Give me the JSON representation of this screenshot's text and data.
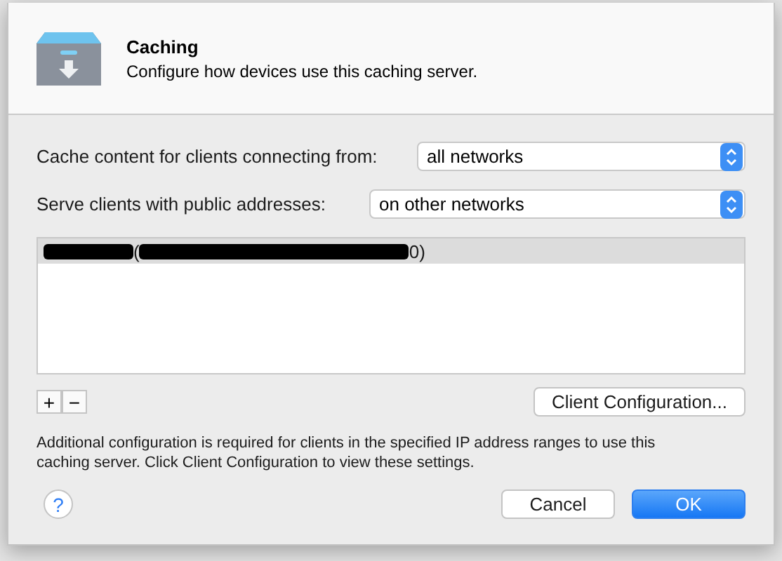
{
  "header": {
    "title": "Caching",
    "subtitle": "Configure how devices use this caching server."
  },
  "settings": [
    {
      "label": "Cache content for clients connecting from:",
      "value": "all networks"
    },
    {
      "label": "Serve clients with public addresses:",
      "value": "on other networks"
    }
  ],
  "ranges": [
    {
      "selected": true,
      "redacted": true,
      "text_before": "(",
      "text_after": "0)"
    }
  ],
  "list_buttons": [
    "+",
    "−"
  ],
  "client_config_button": "Client Configuration...",
  "note": "Additional configuration is required for clients in the specified IP address ranges to use this caching server. Click Client Configuration to view these settings.",
  "help_button": "?",
  "buttons": [
    {
      "label": "Cancel",
      "kind": "secondary"
    },
    {
      "label": "OK",
      "kind": "primary"
    }
  ]
}
